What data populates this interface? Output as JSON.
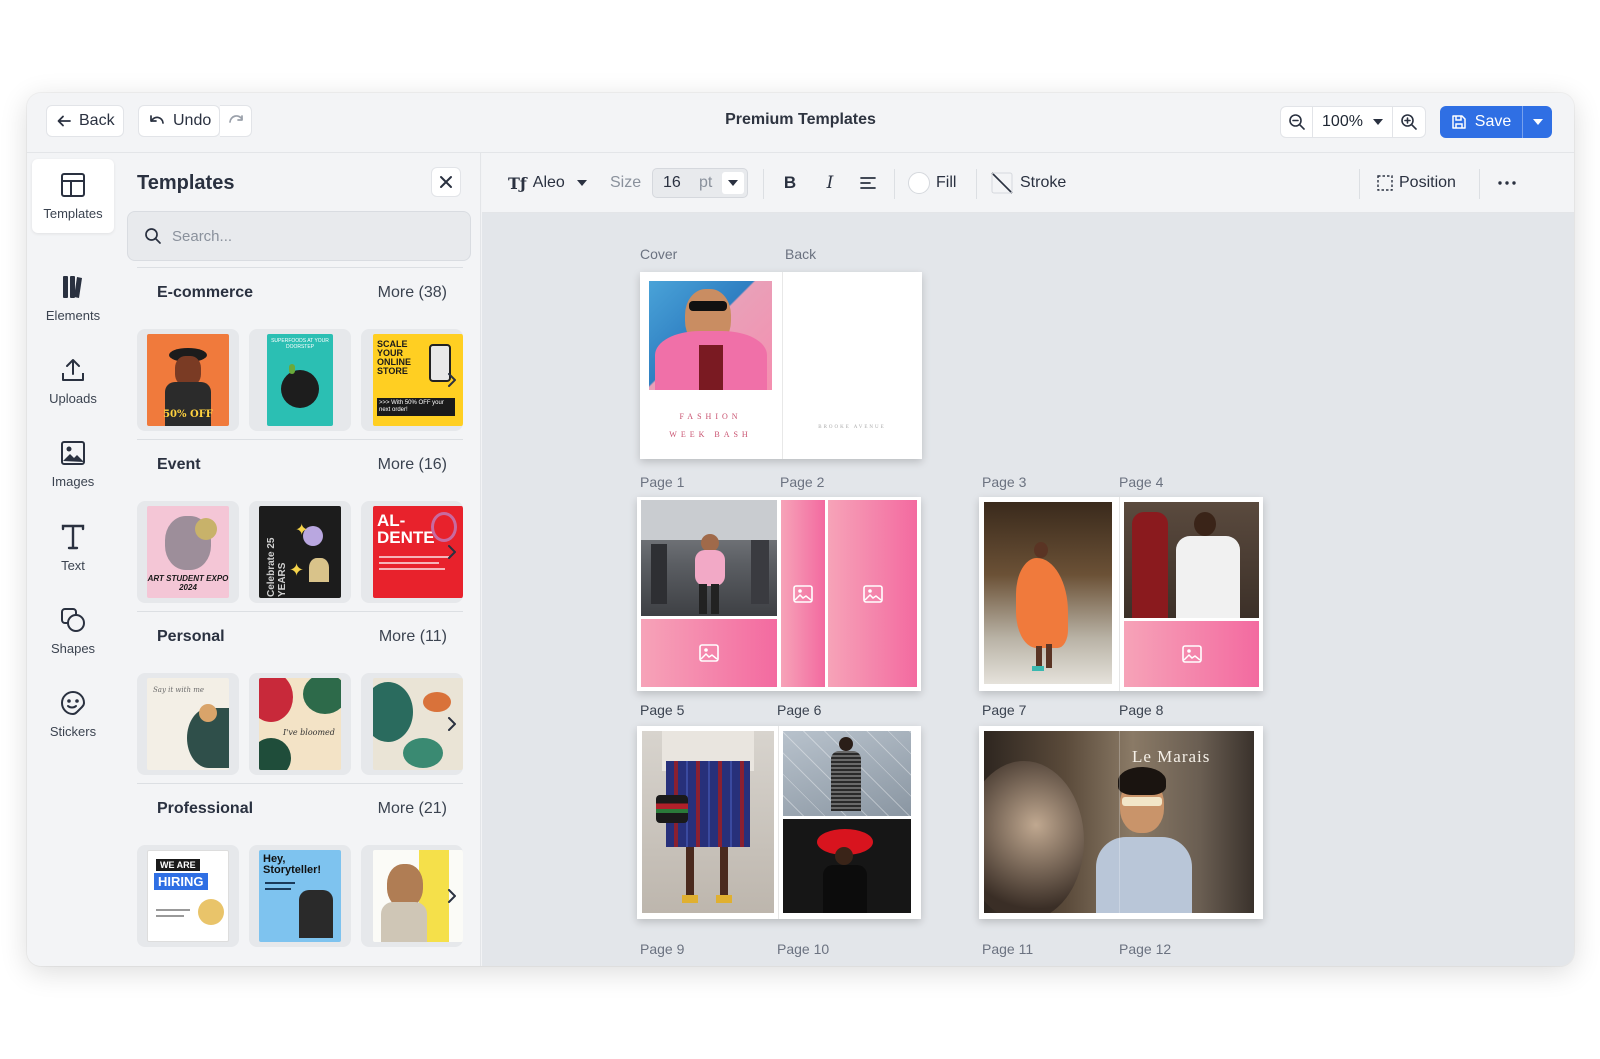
{
  "topbar": {
    "back_label": "Back",
    "undo_label": "Undo",
    "title": "Premium Templates",
    "zoom_value": "100%",
    "save_label": "Save"
  },
  "rail": {
    "items": [
      {
        "label": "Templates",
        "icon": "templates-icon"
      },
      {
        "label": "Elements",
        "icon": "elements-icon"
      },
      {
        "label": "Uploads",
        "icon": "upload-icon"
      },
      {
        "label": "Images",
        "icon": "image-icon"
      },
      {
        "label": "Text",
        "icon": "text-icon"
      },
      {
        "label": "Shapes",
        "icon": "shapes-icon"
      },
      {
        "label": "Stickers",
        "icon": "sticker-icon"
      }
    ]
  },
  "panel": {
    "title": "Templates",
    "search_placeholder": "Search...",
    "categories": [
      {
        "name": "E-commerce",
        "more": "More (38)",
        "thumbs": [
          "SCALE YOUR ONLINE STORE",
          "SUPERFOODS",
          "50% OFF"
        ]
      },
      {
        "name": "Event",
        "more": "More (16)",
        "thumbs": [
          "ART STUDENT EXPO 2024",
          "Celebrate 25 YEARS",
          "AL-DENTE"
        ]
      },
      {
        "name": "Personal",
        "more": "More (11)",
        "thumbs": [
          "Say it with me",
          "I've bloomed",
          "floral"
        ]
      },
      {
        "name": "Professional",
        "more": "More (21)",
        "thumbs": [
          "WE ARE HIRING",
          "Hey, Storyteller!",
          "portrait"
        ]
      }
    ],
    "thumb_texts": {
      "ecom1": "50% OFF",
      "ecom3_a": "SCALE YOUR ONLINE STORE",
      "ecom3_b": ">>> With 50% OFF your next order!",
      "event1": "ART STUDENT EXPO 2024",
      "event2": "Celebrate 25 YEARS",
      "event3": "AL-DENTE",
      "prof1_a": "WE ARE",
      "prof1_b": "HIRING",
      "prof2": "Hey, Storyteller!"
    }
  },
  "toolbar": {
    "font": "Aleo",
    "size_label": "Size",
    "size_value": "16",
    "size_unit": "pt",
    "fill_label": "Fill",
    "stroke_label": "Stroke",
    "position_label": "Position"
  },
  "canvas": {
    "labels": {
      "cover": "Cover",
      "back": "Back",
      "p1": "Page 1",
      "p2": "Page 2",
      "p3": "Page 3",
      "p4": "Page 4",
      "p5": "Page 5",
      "p6": "Page 6",
      "p7": "Page 7",
      "p8": "Page 8",
      "p9": "Page 9",
      "p10": "Page 10",
      "p11": "Page 11",
      "p12": "Page 12"
    },
    "cover_text_1": "FASHION",
    "cover_text_2": "WEEK BASH",
    "back_text": "BROOKE AVENUE",
    "spread_title": "Le Marais"
  },
  "colors": {
    "accent": "#2f6fe4",
    "pink": "#f36aa0",
    "canvas": "#e3e6ea"
  }
}
